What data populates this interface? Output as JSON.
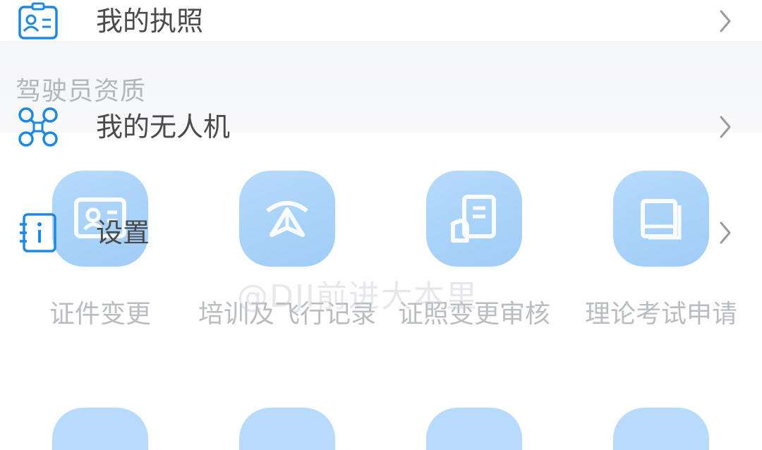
{
  "background_screen": {
    "section_title": "驾驶员资质",
    "tiles": [
      {
        "label": "证件变更",
        "icon": "id-card-icon"
      },
      {
        "label": "培训及飞行记录",
        "icon": "paper-plane-icon"
      },
      {
        "label": "证照变更审核",
        "icon": "document-review-icon"
      },
      {
        "label": "理论考试申请",
        "icon": "book-icon"
      }
    ],
    "watermark": "@DJI前进大本里"
  },
  "menu": {
    "items": [
      {
        "label": "我的执照",
        "icon": "license-icon"
      },
      {
        "label": "我的无人机",
        "icon": "drone-icon"
      },
      {
        "label": "设置",
        "icon": "settings-info-icon"
      }
    ]
  },
  "colors": {
    "accent": "#1e88e5",
    "tile": "#9fcdf8",
    "label_faded": "#b9bcc1",
    "menu_text": "#4a4a4a"
  }
}
